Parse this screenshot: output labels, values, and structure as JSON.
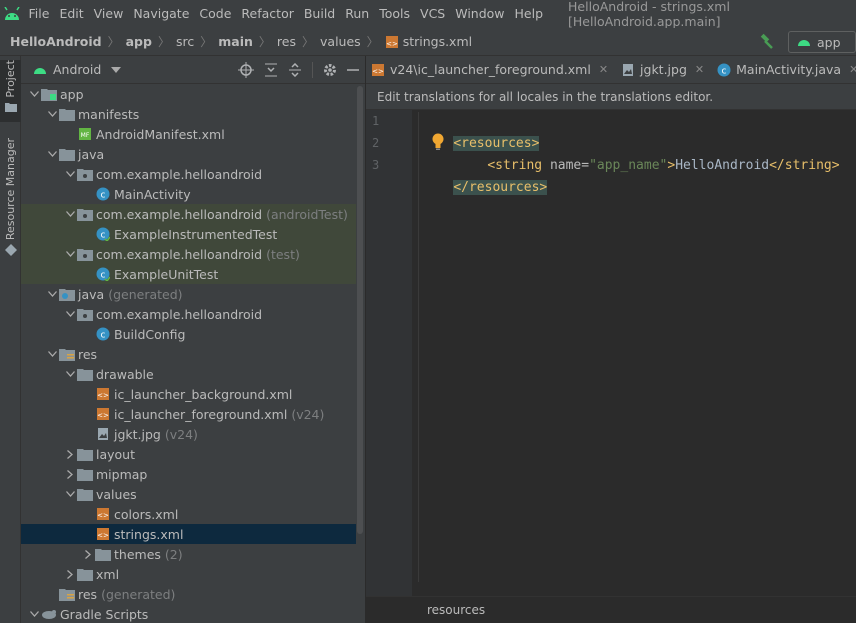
{
  "menubar": {
    "items": [
      "File",
      "Edit",
      "View",
      "Navigate",
      "Code",
      "Refactor",
      "Build",
      "Run",
      "Tools",
      "VCS",
      "Window",
      "Help"
    ],
    "window_title": "HelloAndroid - strings.xml [HelloAndroid.app.main]"
  },
  "breadcrumb": {
    "items": [
      "HelloAndroid",
      "app",
      "src",
      "main",
      "res",
      "values",
      "strings.xml"
    ]
  },
  "run_config": {
    "label": "app"
  },
  "toolstrip": {
    "project_label": "Project",
    "resource_manager_label": "Resource Manager"
  },
  "project_panel": {
    "view_name": "Android",
    "tree": [
      {
        "label": "app",
        "suffix": "",
        "depth": 0,
        "arrow": "down",
        "icon": "module-folder-icon"
      },
      {
        "label": "manifests",
        "suffix": "",
        "depth": 1,
        "arrow": "down",
        "icon": "folder-icon"
      },
      {
        "label": "AndroidManifest.xml",
        "suffix": "",
        "depth": 2,
        "arrow": "none",
        "icon": "manifest-file-icon"
      },
      {
        "label": "java",
        "suffix": "",
        "depth": 1,
        "arrow": "down",
        "icon": "folder-icon"
      },
      {
        "label": "com.example.helloandroid",
        "suffix": "",
        "depth": 2,
        "arrow": "down",
        "icon": "package-icon"
      },
      {
        "label": "MainActivity",
        "suffix": "",
        "depth": 3,
        "arrow": "none",
        "icon": "class-icon"
      },
      {
        "label": "com.example.helloandroid",
        "suffix": "(androidTest)",
        "depth": 2,
        "arrow": "down",
        "icon": "package-icon",
        "green": true
      },
      {
        "label": "ExampleInstrumentedTest",
        "suffix": "",
        "depth": 3,
        "arrow": "none",
        "icon": "test-class-icon",
        "green": true
      },
      {
        "label": "com.example.helloandroid",
        "suffix": "(test)",
        "depth": 2,
        "arrow": "down",
        "icon": "package-icon",
        "green": true
      },
      {
        "label": "ExampleUnitTest",
        "suffix": "",
        "depth": 3,
        "arrow": "none",
        "icon": "test-class-icon",
        "green": true
      },
      {
        "label": "java",
        "suffix": "(generated)",
        "depth": 1,
        "arrow": "down",
        "icon": "generated-folder-icon"
      },
      {
        "label": "com.example.helloandroid",
        "suffix": "",
        "depth": 2,
        "arrow": "down",
        "icon": "package-icon"
      },
      {
        "label": "BuildConfig",
        "suffix": "",
        "depth": 3,
        "arrow": "none",
        "icon": "class-icon"
      },
      {
        "label": "res",
        "suffix": "",
        "depth": 1,
        "arrow": "down",
        "icon": "res-folder-icon"
      },
      {
        "label": "drawable",
        "suffix": "",
        "depth": 2,
        "arrow": "down",
        "icon": "folder-icon"
      },
      {
        "label": "ic_launcher_background.xml",
        "suffix": "",
        "depth": 3,
        "arrow": "none",
        "icon": "xml-file-icon"
      },
      {
        "label": "ic_launcher_foreground.xml",
        "suffix": "(v24)",
        "depth": 3,
        "arrow": "none",
        "icon": "xml-file-icon"
      },
      {
        "label": "jgkt.jpg",
        "suffix": "(v24)",
        "depth": 3,
        "arrow": "none",
        "icon": "image-file-icon"
      },
      {
        "label": "layout",
        "suffix": "",
        "depth": 2,
        "arrow": "right",
        "icon": "folder-icon"
      },
      {
        "label": "mipmap",
        "suffix": "",
        "depth": 2,
        "arrow": "right",
        "icon": "folder-icon"
      },
      {
        "label": "values",
        "suffix": "",
        "depth": 2,
        "arrow": "down",
        "icon": "folder-icon"
      },
      {
        "label": "colors.xml",
        "suffix": "",
        "depth": 3,
        "arrow": "none",
        "icon": "xml-file-icon"
      },
      {
        "label": "strings.xml",
        "suffix": "",
        "depth": 3,
        "arrow": "none",
        "icon": "xml-file-icon",
        "selected": true
      },
      {
        "label": "themes",
        "suffix": "(2)",
        "depth": 3,
        "arrow": "right",
        "icon": "folder-icon"
      },
      {
        "label": "xml",
        "suffix": "",
        "depth": 2,
        "arrow": "right",
        "icon": "folder-icon"
      },
      {
        "label": "res",
        "suffix": "(generated)",
        "depth": 1,
        "arrow": "none",
        "icon": "res-folder-icon"
      },
      {
        "label": "Gradle Scripts",
        "suffix": "",
        "depth": 0,
        "arrow": "down",
        "icon": "gradle-icon"
      }
    ]
  },
  "editor": {
    "tabs": [
      {
        "label": "v24\\ic_launcher_foreground.xml",
        "icon": "xml-file-icon",
        "close": true
      },
      {
        "label": "jgkt.jpg",
        "icon": "image-file-icon",
        "close": true
      },
      {
        "label": "MainActivity.java",
        "icon": "class-icon",
        "close": true
      },
      {
        "label": "co",
        "icon": "class-icon",
        "close": false
      }
    ],
    "banner": "Edit translations for all locales in the translations editor.",
    "line_numbers": [
      "1",
      "2",
      "3"
    ],
    "code": {
      "line1_tag": "<resources>",
      "line2_open": "<string ",
      "line2_attr": "name=",
      "line2_val": "\"app_name\"",
      "line2_gt": ">",
      "line2_text": "HelloAndroid",
      "line2_close": "</string>",
      "line3_tag": "</resources>"
    },
    "status_path": "resources"
  },
  "colors": {
    "accent_green": "#499c54",
    "android_green": "#3ddc84",
    "class_blue": "#3592c4",
    "xml_orange": "#cc7832"
  }
}
